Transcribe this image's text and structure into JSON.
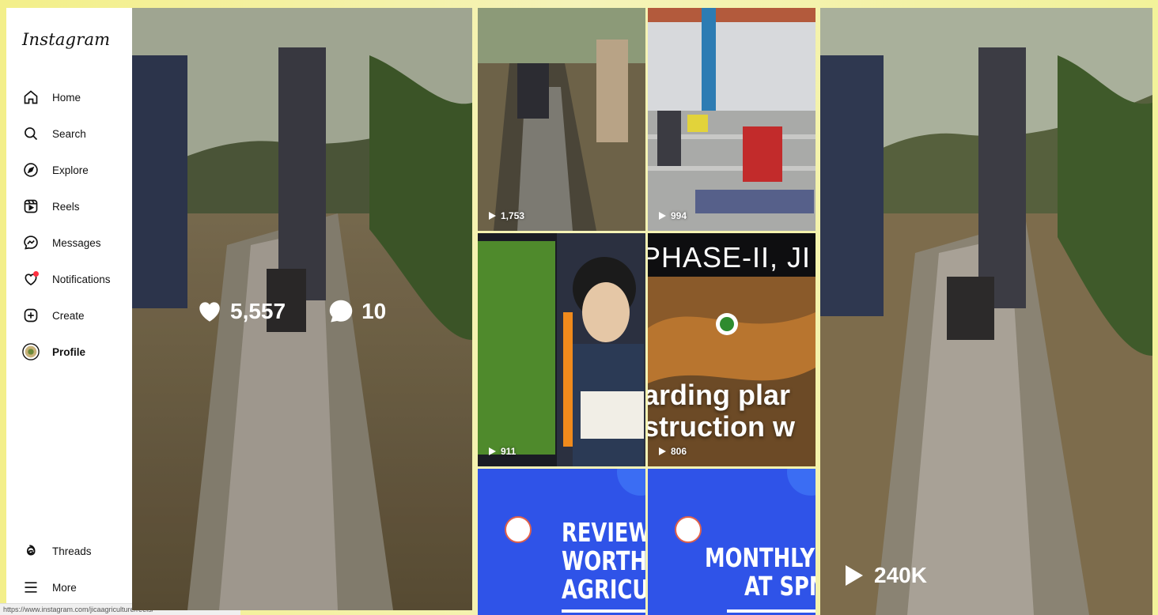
{
  "sidebar": {
    "logo": "Instagram",
    "items": [
      {
        "label": "Home",
        "icon": "home-icon"
      },
      {
        "label": "Search",
        "icon": "search-icon"
      },
      {
        "label": "Explore",
        "icon": "explore-icon"
      },
      {
        "label": "Reels",
        "icon": "reels-icon"
      },
      {
        "label": "Messages",
        "icon": "messages-icon"
      },
      {
        "label": "Notifications",
        "icon": "heart-icon"
      },
      {
        "label": "Create",
        "icon": "plus-square-icon"
      },
      {
        "label": "Profile",
        "icon": "avatar-icon"
      }
    ],
    "bottom": [
      {
        "label": "Threads",
        "icon": "threads-icon"
      },
      {
        "label": "More",
        "icon": "menu-icon"
      }
    ]
  },
  "status_url": "https://www.instagram.com/jicaagriculture/reels/",
  "main_post": {
    "likes": "5,557",
    "comments": "10"
  },
  "grid": {
    "tiles": [
      {
        "views": "1,753"
      },
      {
        "views": "994"
      },
      {
        "views": "911"
      },
      {
        "views": "806",
        "line1": "PHASE-II, JI",
        "line2": "arding plar",
        "line3": "struction w"
      },
      {
        "line1": "REVIEW M",
        "line2": "WORTHY",
        "line3": "AGRICULT"
      },
      {
        "line1": "MONTHLY RE",
        "line2": "AT SPMU"
      }
    ]
  },
  "right_reel": {
    "views": "240K"
  },
  "colors": {
    "accent_blue": "#2f53e8",
    "notification_dot": "#ff3040"
  }
}
